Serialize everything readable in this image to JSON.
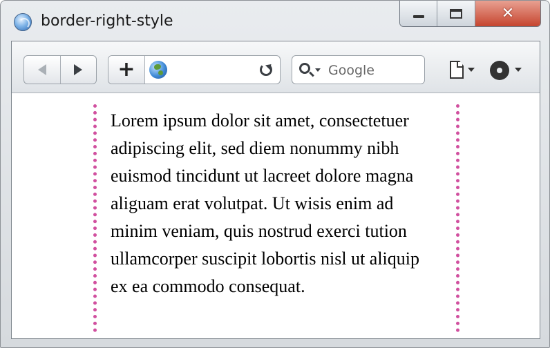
{
  "window": {
    "title": "border-right-style",
    "controls": {
      "minimize": "minimize",
      "maximize": "maximize",
      "close": "✕"
    }
  },
  "toolbar": {
    "add_label": "+",
    "url_value": "",
    "search": {
      "placeholder": "Google"
    }
  },
  "content": {
    "paragraph": "Lorem ipsum dolor sit amet, consectetuer adipiscing elit, sed diem nonummy nibh euismod tincidunt ut lacreet dolore magna aliguam erat volutpat. Ut wisis enim ad minim veniam, quis nostrud exerci tution ullamcorper suscipit lobortis nisl ut aliquip ex ea commodo consequat.",
    "border_color": "#d1509f"
  },
  "icons": [
    "app-icon",
    "back-icon",
    "forward-icon",
    "globe-icon",
    "reload-icon",
    "search-icon",
    "page-icon",
    "gear-icon"
  ]
}
